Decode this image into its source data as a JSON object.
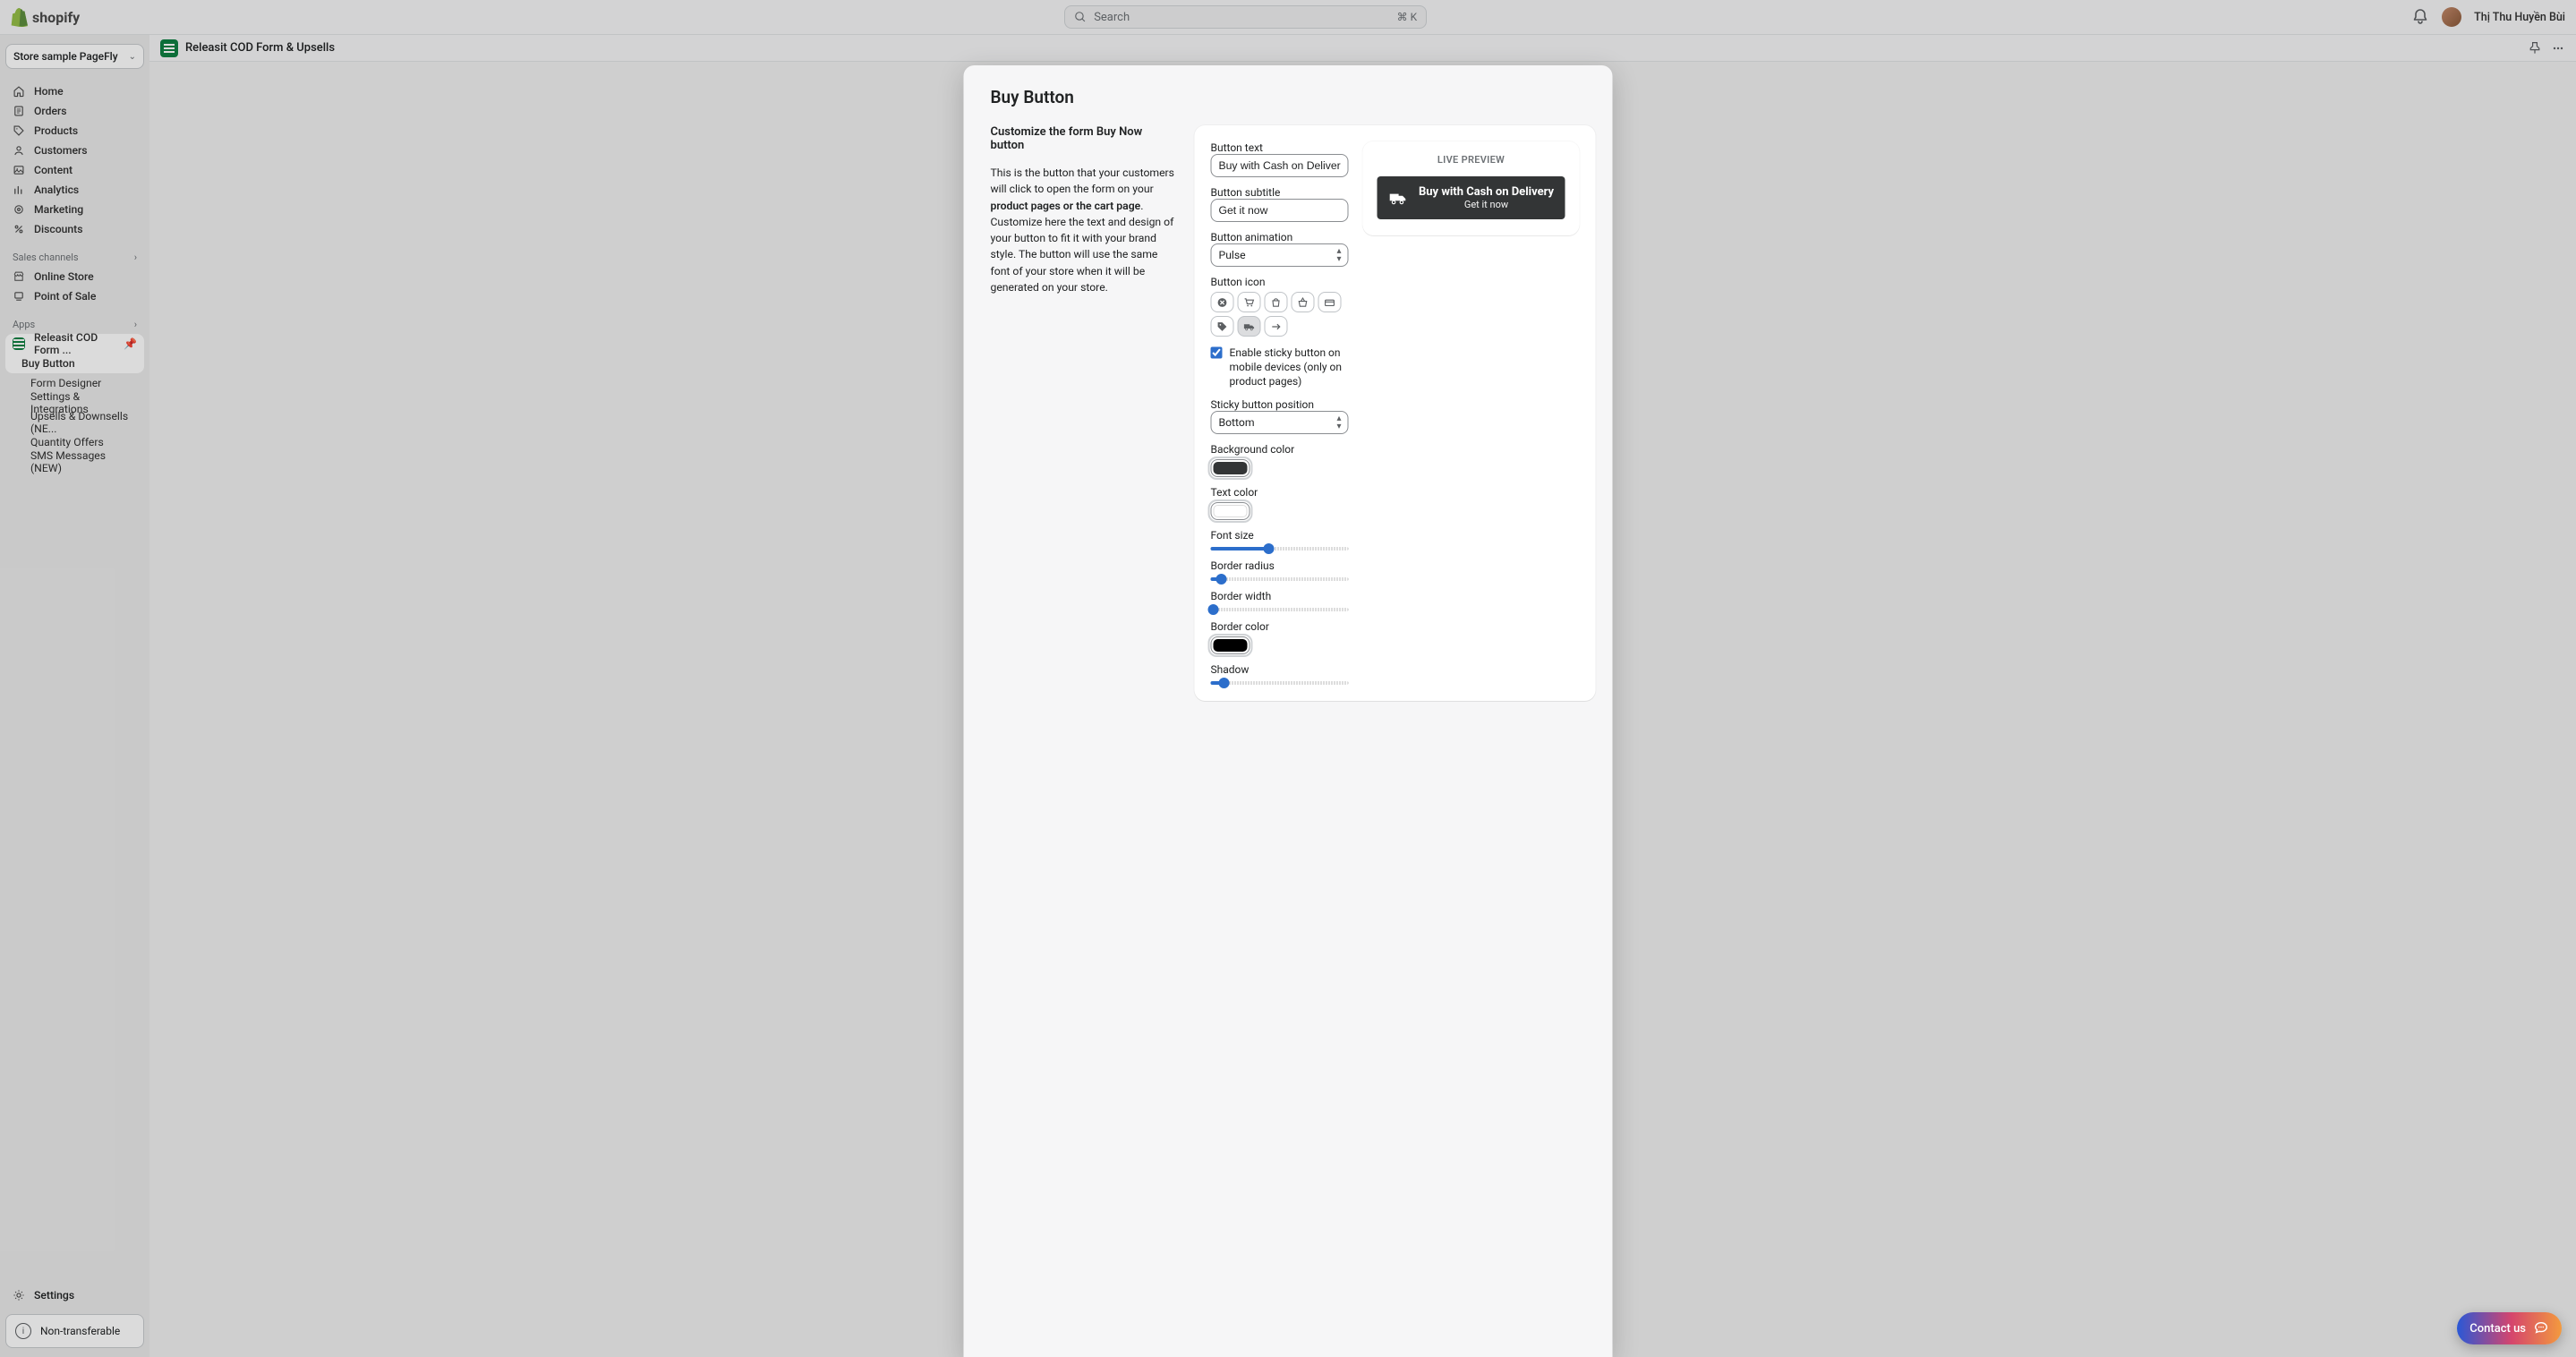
{
  "topbar": {
    "brand": "shopify",
    "search_placeholder": "Search",
    "kbd": "⌘ K",
    "user": "Thị Thu Huyền Bùi"
  },
  "app_header": {
    "title": "Releasit COD Form & Upsells"
  },
  "sidebar": {
    "store": "Store sample PageFly",
    "items": [
      {
        "name": "home",
        "label": "Home"
      },
      {
        "name": "orders",
        "label": "Orders"
      },
      {
        "name": "products",
        "label": "Products"
      },
      {
        "name": "customers",
        "label": "Customers"
      },
      {
        "name": "content",
        "label": "Content"
      },
      {
        "name": "analytics",
        "label": "Analytics"
      },
      {
        "name": "marketing",
        "label": "Marketing"
      },
      {
        "name": "discounts",
        "label": "Discounts"
      }
    ],
    "sales_heading": "Sales channels",
    "channels": [
      {
        "name": "online-store",
        "label": "Online Store"
      },
      {
        "name": "pos",
        "label": "Point of Sale"
      }
    ],
    "apps_heading": "Apps",
    "app_label_short": "Releasit COD Form ...",
    "app_subs": [
      {
        "name": "buy-button",
        "label": "Buy Button",
        "selected": true
      },
      {
        "name": "form-designer",
        "label": "Form Designer"
      },
      {
        "name": "settings-integrations",
        "label": "Settings & Integrations"
      },
      {
        "name": "upsells",
        "label": "Upsells & Downsells (NE..."
      },
      {
        "name": "quantity-offers",
        "label": "Quantity Offers"
      },
      {
        "name": "sms",
        "label": "SMS Messages (NEW)"
      }
    ],
    "settings_label": "Settings",
    "nontransfer": "Non-transferable"
  },
  "modal": {
    "title": "Buy Button",
    "section_title": "Customize the form Buy Now button",
    "desc_a": "This is the button that your customers will click to open the form on your ",
    "desc_b": "product pages or the cart page",
    "desc_c": ". Customize here the text and design of your button to fit it with your brand style. The button will use the same font of your store when it will be generated on your store.",
    "form": {
      "button_text_label": "Button text",
      "button_text_value": "Buy with Cash on Delivery",
      "button_subtitle_label": "Button subtitle",
      "button_subtitle_value": "Get it now",
      "animation_label": "Button animation",
      "animation_value": "Pulse",
      "icon_label": "Button icon",
      "icons": [
        "cancel",
        "cart",
        "shopping-bag",
        "basket",
        "card",
        "tag",
        "truck",
        "arrow-right"
      ],
      "selected_icon": "truck",
      "sticky_enable_label": "Enable sticky button on mobile devices (only on product pages)",
      "sticky_label": "Sticky button position",
      "sticky_value": "Bottom",
      "bg_label": "Background color",
      "bg_value": "#333536",
      "text_color_label": "Text color",
      "text_color_value": "#ffffff",
      "font_size_label": "Font size",
      "font_size_pct": 42,
      "border_radius_label": "Border radius",
      "border_radius_pct": 8,
      "border_width_label": "Border width",
      "border_width_pct": 2,
      "border_color_label": "Border color",
      "border_color_value": "#000000",
      "shadow_label": "Shadow",
      "shadow_pct": 10
    },
    "preview": {
      "heading": "LIVE PREVIEW",
      "line1": "Buy with Cash on Delivery",
      "line2": "Get it now"
    }
  },
  "contact_label": "Contact us"
}
